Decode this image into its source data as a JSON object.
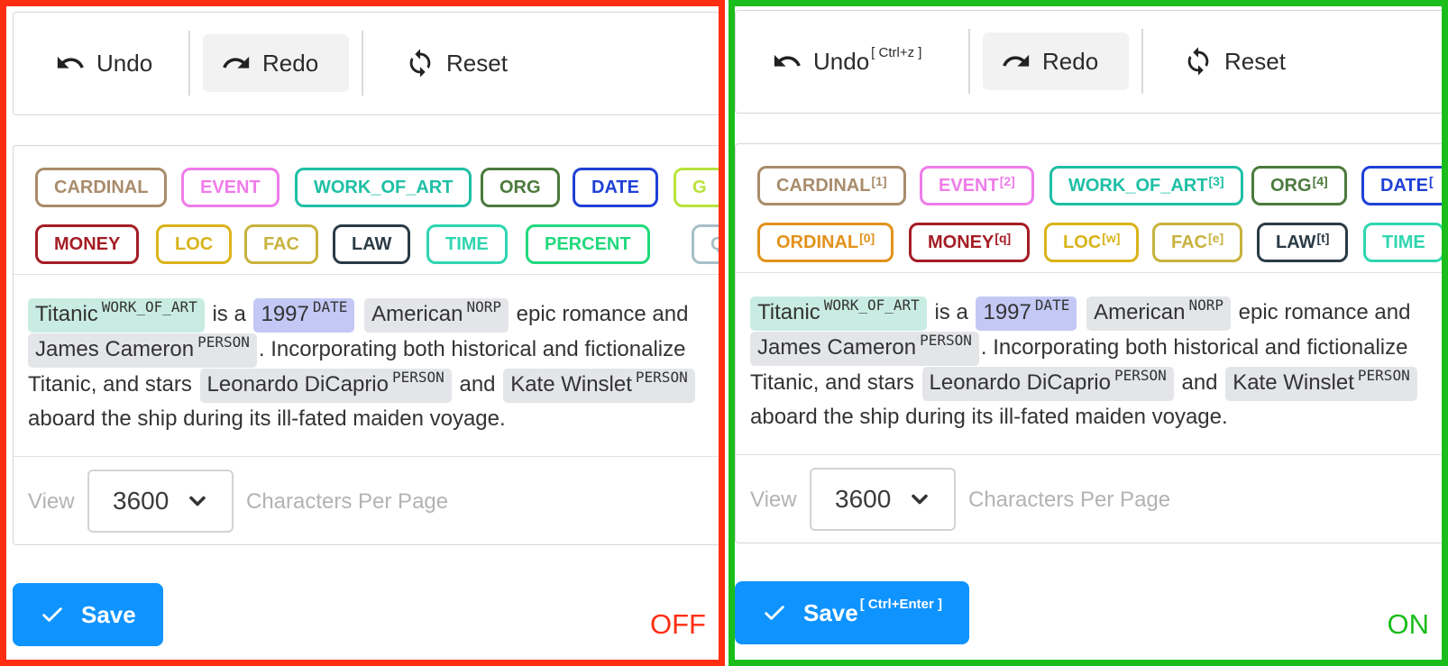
{
  "toolbar": {
    "undo": "Undo",
    "undo_shortcut": "[ Ctrl+z ]",
    "redo": "Redo",
    "reset": "Reset"
  },
  "labels_off": [
    {
      "text": "CARDINAL",
      "color": "#a98c6b"
    },
    {
      "text": "EVENT",
      "color": "#ef7ce9"
    },
    {
      "text": "WORK_OF_ART",
      "color": "#1fbfa5"
    },
    {
      "text": "ORG",
      "color": "#4b7a3c"
    },
    {
      "text": "DATE",
      "color": "#1f40d6"
    },
    {
      "text": "G",
      "color": "#b9e33a"
    },
    {
      "text": "MONEY",
      "color": "#a51d25"
    },
    {
      "text": "LOC",
      "color": "#d9b31a"
    },
    {
      "text": "FAC",
      "color": "#c8b23e"
    },
    {
      "text": "LAW",
      "color": "#2a3b45"
    },
    {
      "text": "TIME",
      "color": "#2ed6b0"
    },
    {
      "text": "PERCENT",
      "color": "#21d97c"
    },
    {
      "text": "QU",
      "color": "#a8bfc8"
    }
  ],
  "labels_on": [
    {
      "text": "CARDINAL",
      "key": "[1]",
      "color": "#a98c6b"
    },
    {
      "text": "EVENT",
      "key": "[2]",
      "color": "#ef7ce9"
    },
    {
      "text": "WORK_OF_ART",
      "key": "[3]",
      "color": "#1fbfa5"
    },
    {
      "text": "ORG",
      "key": "[4]",
      "color": "#4b7a3c"
    },
    {
      "text": "DATE",
      "key": "[",
      "color": "#1f40d6"
    },
    {
      "text": "ORDINAL",
      "key": "[0]",
      "color": "#e2921a"
    },
    {
      "text": "MONEY",
      "key": "[q]",
      "color": "#a51d25"
    },
    {
      "text": "LOC",
      "key": "[w]",
      "color": "#d9b31a"
    },
    {
      "text": "FAC",
      "key": "[e]",
      "color": "#c8b23e"
    },
    {
      "text": "LAW",
      "key": "[t]",
      "color": "#2a3b45"
    },
    {
      "text": "TIME",
      "key": "",
      "color": "#2ed6b0"
    }
  ],
  "text": {
    "line1": {
      "e1": "Titanic",
      "e1_tag": "WORK_OF_ART",
      "t1": "is a",
      "e2": "1997",
      "e2_tag": "DATE",
      "e3": "American",
      "e3_tag": "NORP",
      "t2": "epic romance and"
    },
    "line2": {
      "e1": "James Cameron",
      "e1_tag": "PERSON",
      "t1": ". Incorporating both historical and fictionalize"
    },
    "line3": {
      "t1": "Titanic, and stars",
      "e1": "Leonardo DiCaprio",
      "e1_tag": "PERSON",
      "t2": "and",
      "e2": "Kate Winslet",
      "e2_tag": "PERSON"
    },
    "line4": {
      "t1": "aboard the ship during its ill-fated maiden voyage."
    }
  },
  "entity_colors": {
    "work_of_art": "#c9ece2",
    "date": "#c3c8f5",
    "norp": "#e3e5e8",
    "person": "#e3e5e8"
  },
  "footer": {
    "view": "View",
    "chars_per_page_value": "3600",
    "chars_per_page_label": "Characters Per Page"
  },
  "save": {
    "label": "Save",
    "shortcut": "[ Ctrl+Enter ]"
  },
  "modes": {
    "off": "OFF",
    "on": "ON",
    "off_color": "#ff2d12",
    "on_color": "#1bbd1b"
  }
}
